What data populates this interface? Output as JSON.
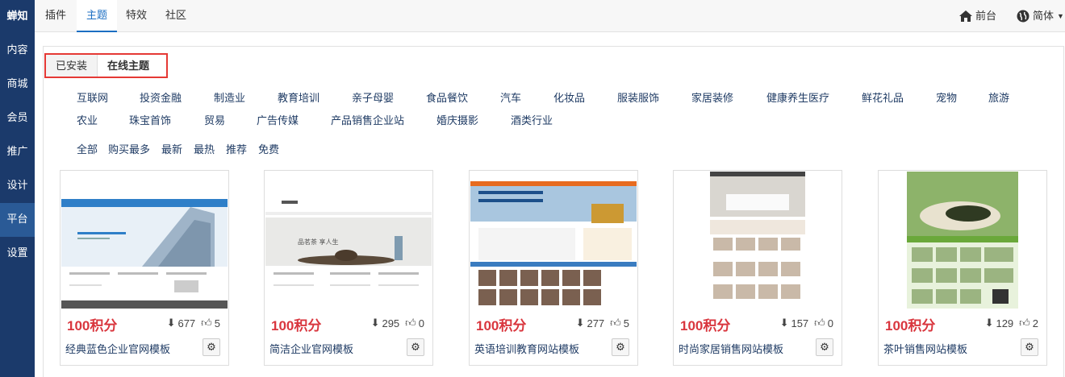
{
  "sidebar": {
    "items": [
      {
        "label": "蝉知"
      },
      {
        "label": "内容"
      },
      {
        "label": "商城"
      },
      {
        "label": "会员"
      },
      {
        "label": "推广"
      },
      {
        "label": "设计"
      },
      {
        "label": "平台"
      },
      {
        "label": "设置"
      }
    ]
  },
  "topbar": {
    "tabs": [
      {
        "label": "插件"
      },
      {
        "label": "主题"
      },
      {
        "label": "特效"
      },
      {
        "label": "社区"
      }
    ],
    "frontend_label": "前台",
    "language_label": "简体"
  },
  "subtabs": {
    "installed": "已安装",
    "online": "在线主题"
  },
  "categories": {
    "row1": [
      "互联网",
      "投资金融",
      "制造业",
      "教育培训",
      "亲子母婴",
      "食品餐饮",
      "汽车",
      "化妆品",
      "服装服饰",
      "家居装修",
      "健康养生医疗",
      "鲜花礼品",
      "宠物",
      "旅游"
    ],
    "row2": [
      "农业",
      "珠宝首饰",
      "贸易",
      "广告传媒",
      "产品销售企业站",
      "婚庆摄影",
      "酒类行业"
    ]
  },
  "filters": [
    "全部",
    "购买最多",
    "最新",
    "最热",
    "推荐",
    "免费"
  ],
  "themes": [
    {
      "price": "100积分",
      "downloads": "677",
      "likes": "5",
      "name": "经典蓝色企业官网模板"
    },
    {
      "price": "100积分",
      "downloads": "295",
      "likes": "0",
      "name": "简洁企业官网模板"
    },
    {
      "price": "100积分",
      "downloads": "277",
      "likes": "5",
      "name": "英语培训教育网站模板"
    },
    {
      "price": "100积分",
      "downloads": "157",
      "likes": "0",
      "name": "时尚家居销售网站模板"
    },
    {
      "price": "100积分",
      "downloads": "129",
      "likes": "2",
      "name": "茶叶销售网站模板"
    }
  ],
  "colors": {
    "sidebar": "#1b3a6b",
    "sidebar_active": "#2a5a96",
    "price": "#d9363e",
    "link": "#1f3b64",
    "highlight": "#e53935"
  }
}
